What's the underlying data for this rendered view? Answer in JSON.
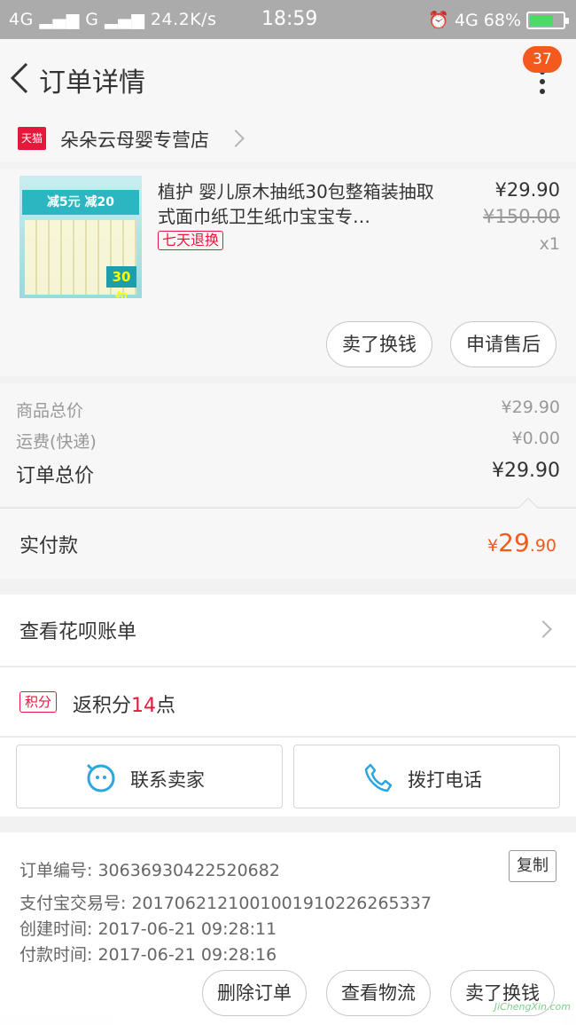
{
  "status_bar": {
    "network": "4G",
    "carrier": "G",
    "speed": "24.2K/s",
    "time": "18:59",
    "right_network": "4G",
    "battery": "68%"
  },
  "nav": {
    "title": "订单详情",
    "badge": "37"
  },
  "store": {
    "badge": "天猫",
    "name": "朵朵云母婴专营店"
  },
  "product": {
    "name": "植护 婴儿原木抽纸30包整箱装抽取式面巾纸卫生纸巾宝宝专…",
    "tag": "七天退换",
    "price": "¥29.90",
    "original_price": "¥150.00",
    "quantity": "x1",
    "thumb_banner": "减5元 减20",
    "thumb_count": "30包",
    "buttons": [
      "卖了换钱",
      "申请售后"
    ]
  },
  "summary": {
    "rows": [
      {
        "label": "商品总价",
        "value": "¥29.90"
      },
      {
        "label": "运费(快递)",
        "value": "¥0.00"
      },
      {
        "label": "订单总价",
        "value": "¥29.90"
      }
    ]
  },
  "paid": {
    "label": "实付款",
    "currency": "¥",
    "integer": "29",
    "decimal": ".90"
  },
  "huabei": {
    "label": "查看花呗账单"
  },
  "points": {
    "badge": "积分",
    "prefix": "返积分",
    "number": "14",
    "suffix": "点"
  },
  "contact": {
    "seller": "联系卖家",
    "phone": "拨打电话"
  },
  "info": {
    "order_no": "订单编号: 30636930422520682",
    "alipay_no": "支付宝交易号: 2017062121001001910226265337",
    "created": "创建时间: 2017-06-21 09:28:11",
    "paid": "付款时间: 2017-06-21 09:28:16",
    "copy": "复制"
  },
  "bottom": {
    "buttons": [
      "删除订单",
      "查看物流",
      "卖了换钱"
    ]
  },
  "watermark": "JiChengXin.com",
  "colors": {
    "accent": "#f45a1e",
    "tmall_red": "#e5183b",
    "contact_blue": "#2ba6de"
  }
}
